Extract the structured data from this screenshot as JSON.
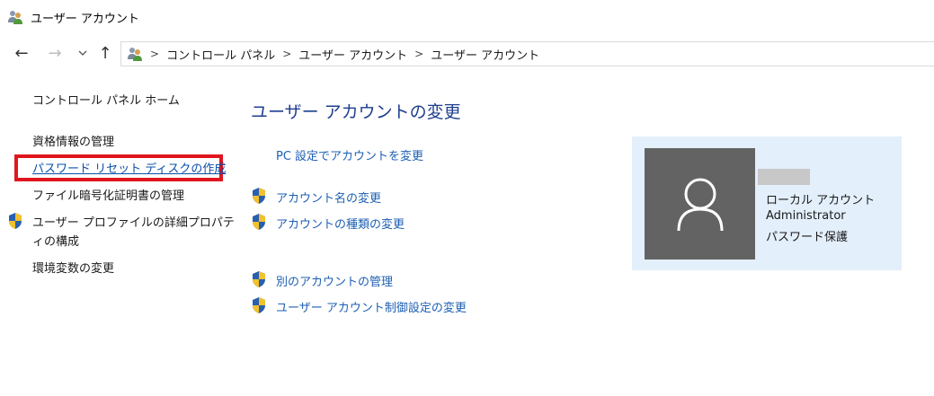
{
  "window": {
    "title": "ユーザー アカウント",
    "icon": "users-icon"
  },
  "navigation": {
    "back": "←",
    "forward": "→",
    "recent": "⌄",
    "up": "↑",
    "breadcrumbs": [
      "コントロール パネル",
      "ユーザー アカウント",
      "ユーザー アカウント"
    ],
    "separator": ">"
  },
  "sidebar": {
    "items": [
      {
        "label": "コントロール パネル ホーム",
        "link": false
      },
      {
        "label": "資格情報の管理",
        "link": false
      },
      {
        "label": "パスワード リセット ディスクの作成",
        "link": true,
        "highlighted": true
      },
      {
        "label": "ファイル暗号化証明書の管理",
        "link": false
      },
      {
        "label": "ユーザー プロファイルの詳細プロパテ",
        "label_cont": "ィの構成",
        "link": false,
        "shield": true
      },
      {
        "label": "環境変数の変更",
        "link": false
      }
    ]
  },
  "main": {
    "heading": "ユーザー アカウントの変更",
    "tasks": [
      {
        "label": "PC 設定でアカウントを変更",
        "shield": false
      },
      {
        "label": "アカウント名の変更",
        "shield": true
      },
      {
        "label": "アカウントの種類の変更",
        "shield": true
      },
      {
        "label": "別のアカウントの管理",
        "shield": true
      },
      {
        "label": "ユーザー アカウント制御設定の変更",
        "shield": true
      }
    ]
  },
  "account": {
    "type": "ローカル アカウント",
    "role": "Administrator",
    "status": "パスワード保護"
  },
  "colors": {
    "link": "#1d5fb3",
    "heading": "#1e3f8f",
    "highlight": "#e0151e",
    "panel": "#e3effb",
    "avatar": "#636363"
  }
}
